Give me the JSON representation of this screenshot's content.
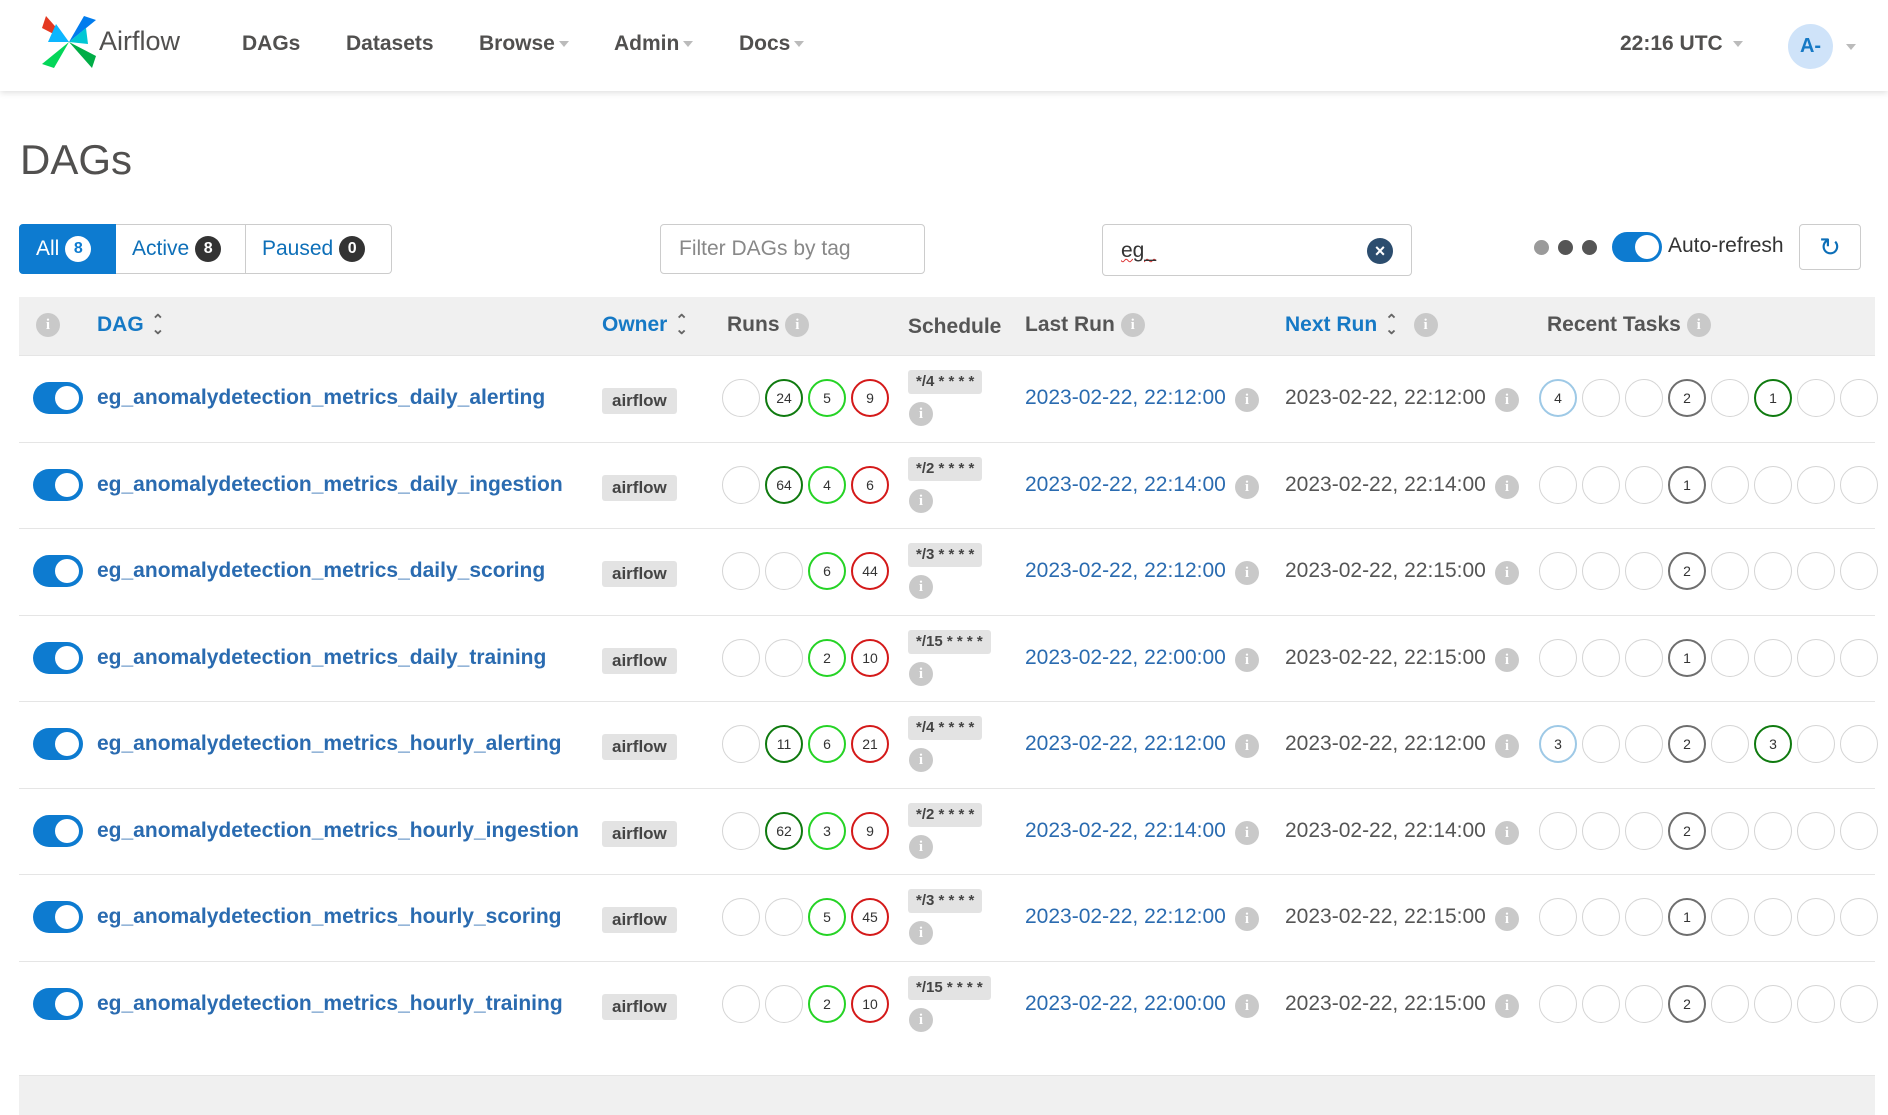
{
  "nav": {
    "brand": "Airflow",
    "items": [
      {
        "label": "DAGs",
        "dropdown": false
      },
      {
        "label": "Datasets",
        "dropdown": false
      },
      {
        "label": "Browse",
        "dropdown": true
      },
      {
        "label": "Admin",
        "dropdown": true
      },
      {
        "label": "Docs",
        "dropdown": true
      }
    ],
    "clock": "22:16 UTC",
    "avatar": "A-"
  },
  "page_title": "DAGs",
  "filters": {
    "status": [
      {
        "label": "All",
        "count": "8"
      },
      {
        "label": "Active",
        "count": "8"
      },
      {
        "label": "Paused",
        "count": "0"
      }
    ],
    "tag_placeholder": "Filter DAGs by tag",
    "search_value": "eg_",
    "autorefresh_label": "Auto-refresh"
  },
  "columns": {
    "dag": "DAG",
    "owner": "Owner",
    "runs": "Runs",
    "schedule": "Schedule",
    "last_run": "Last Run",
    "next_run": "Next Run",
    "recent_tasks": "Recent Tasks"
  },
  "colors": {
    "accent": "#0d7bd0",
    "success_dark": "#0f7a0f",
    "running": "#25d325",
    "failed": "#d41919",
    "grey": "#6e6e6e",
    "queued": "#9ec9e6"
  },
  "dags": [
    {
      "name": "eg_anomalydetection_metrics_daily_alerting",
      "owner": "airflow",
      "runs": [
        {
          "v": "",
          "c": ""
        },
        {
          "v": "24",
          "c": "dg"
        },
        {
          "v": "5",
          "c": "lg"
        },
        {
          "v": "9",
          "c": "rd"
        }
      ],
      "schedule": "*/4 * * * *",
      "last_run": "2023-02-22, 22:12:00",
      "next_run": "2023-02-22, 22:12:00",
      "tasks": [
        {
          "v": "4",
          "c": "lb"
        },
        {
          "v": "",
          "c": ""
        },
        {
          "v": "",
          "c": ""
        },
        {
          "v": "2",
          "c": "gr"
        },
        {
          "v": "",
          "c": ""
        },
        {
          "v": "1",
          "c": "dg"
        },
        {
          "v": "",
          "c": ""
        },
        {
          "v": "",
          "c": ""
        }
      ]
    },
    {
      "name": "eg_anomalydetection_metrics_daily_ingestion",
      "owner": "airflow",
      "runs": [
        {
          "v": "",
          "c": ""
        },
        {
          "v": "64",
          "c": "dg"
        },
        {
          "v": "4",
          "c": "lg"
        },
        {
          "v": "6",
          "c": "rd"
        }
      ],
      "schedule": "*/2 * * * *",
      "last_run": "2023-02-22, 22:14:00",
      "next_run": "2023-02-22, 22:14:00",
      "tasks": [
        {
          "v": "",
          "c": ""
        },
        {
          "v": "",
          "c": ""
        },
        {
          "v": "",
          "c": ""
        },
        {
          "v": "1",
          "c": "gr"
        },
        {
          "v": "",
          "c": ""
        },
        {
          "v": "",
          "c": ""
        },
        {
          "v": "",
          "c": ""
        },
        {
          "v": "",
          "c": ""
        }
      ]
    },
    {
      "name": "eg_anomalydetection_metrics_daily_scoring",
      "owner": "airflow",
      "runs": [
        {
          "v": "",
          "c": ""
        },
        {
          "v": "",
          "c": ""
        },
        {
          "v": "6",
          "c": "lg"
        },
        {
          "v": "44",
          "c": "rd"
        }
      ],
      "schedule": "*/3 * * * *",
      "last_run": "2023-02-22, 22:12:00",
      "next_run": "2023-02-22, 22:15:00",
      "tasks": [
        {
          "v": "",
          "c": ""
        },
        {
          "v": "",
          "c": ""
        },
        {
          "v": "",
          "c": ""
        },
        {
          "v": "2",
          "c": "gr"
        },
        {
          "v": "",
          "c": ""
        },
        {
          "v": "",
          "c": ""
        },
        {
          "v": "",
          "c": ""
        },
        {
          "v": "",
          "c": ""
        }
      ]
    },
    {
      "name": "eg_anomalydetection_metrics_daily_training",
      "owner": "airflow",
      "runs": [
        {
          "v": "",
          "c": ""
        },
        {
          "v": "",
          "c": ""
        },
        {
          "v": "2",
          "c": "lg"
        },
        {
          "v": "10",
          "c": "rd"
        }
      ],
      "schedule": "*/15 * * * *",
      "last_run": "2023-02-22, 22:00:00",
      "next_run": "2023-02-22, 22:15:00",
      "tasks": [
        {
          "v": "",
          "c": ""
        },
        {
          "v": "",
          "c": ""
        },
        {
          "v": "",
          "c": ""
        },
        {
          "v": "1",
          "c": "gr"
        },
        {
          "v": "",
          "c": ""
        },
        {
          "v": "",
          "c": ""
        },
        {
          "v": "",
          "c": ""
        },
        {
          "v": "",
          "c": ""
        }
      ]
    },
    {
      "name": "eg_anomalydetection_metrics_hourly_alerting",
      "owner": "airflow",
      "runs": [
        {
          "v": "",
          "c": ""
        },
        {
          "v": "11",
          "c": "dg"
        },
        {
          "v": "6",
          "c": "lg"
        },
        {
          "v": "21",
          "c": "rd"
        }
      ],
      "schedule": "*/4 * * * *",
      "last_run": "2023-02-22, 22:12:00",
      "next_run": "2023-02-22, 22:12:00",
      "tasks": [
        {
          "v": "3",
          "c": "lb"
        },
        {
          "v": "",
          "c": ""
        },
        {
          "v": "",
          "c": ""
        },
        {
          "v": "2",
          "c": "gr"
        },
        {
          "v": "",
          "c": ""
        },
        {
          "v": "3",
          "c": "dg"
        },
        {
          "v": "",
          "c": ""
        },
        {
          "v": "",
          "c": ""
        }
      ]
    },
    {
      "name": "eg_anomalydetection_metrics_hourly_ingestion",
      "owner": "airflow",
      "runs": [
        {
          "v": "",
          "c": ""
        },
        {
          "v": "62",
          "c": "dg"
        },
        {
          "v": "3",
          "c": "lg"
        },
        {
          "v": "9",
          "c": "rd"
        }
      ],
      "schedule": "*/2 * * * *",
      "last_run": "2023-02-22, 22:14:00",
      "next_run": "2023-02-22, 22:14:00",
      "tasks": [
        {
          "v": "",
          "c": ""
        },
        {
          "v": "",
          "c": ""
        },
        {
          "v": "",
          "c": ""
        },
        {
          "v": "2",
          "c": "gr"
        },
        {
          "v": "",
          "c": ""
        },
        {
          "v": "",
          "c": ""
        },
        {
          "v": "",
          "c": ""
        },
        {
          "v": "",
          "c": ""
        }
      ]
    },
    {
      "name": "eg_anomalydetection_metrics_hourly_scoring",
      "owner": "airflow",
      "runs": [
        {
          "v": "",
          "c": ""
        },
        {
          "v": "",
          "c": ""
        },
        {
          "v": "5",
          "c": "lg"
        },
        {
          "v": "45",
          "c": "rd"
        }
      ],
      "schedule": "*/3 * * * *",
      "last_run": "2023-02-22, 22:12:00",
      "next_run": "2023-02-22, 22:15:00",
      "tasks": [
        {
          "v": "",
          "c": ""
        },
        {
          "v": "",
          "c": ""
        },
        {
          "v": "",
          "c": ""
        },
        {
          "v": "1",
          "c": "gr"
        },
        {
          "v": "",
          "c": ""
        },
        {
          "v": "",
          "c": ""
        },
        {
          "v": "",
          "c": ""
        },
        {
          "v": "",
          "c": ""
        }
      ]
    },
    {
      "name": "eg_anomalydetection_metrics_hourly_training",
      "owner": "airflow",
      "runs": [
        {
          "v": "",
          "c": ""
        },
        {
          "v": "",
          "c": ""
        },
        {
          "v": "2",
          "c": "lg"
        },
        {
          "v": "10",
          "c": "rd"
        }
      ],
      "schedule": "*/15 * * * *",
      "last_run": "2023-02-22, 22:00:00",
      "next_run": "2023-02-22, 22:15:00",
      "tasks": [
        {
          "v": "",
          "c": ""
        },
        {
          "v": "",
          "c": ""
        },
        {
          "v": "",
          "c": ""
        },
        {
          "v": "2",
          "c": "gr"
        },
        {
          "v": "",
          "c": ""
        },
        {
          "v": "",
          "c": ""
        },
        {
          "v": "",
          "c": ""
        },
        {
          "v": "",
          "c": ""
        }
      ]
    }
  ]
}
